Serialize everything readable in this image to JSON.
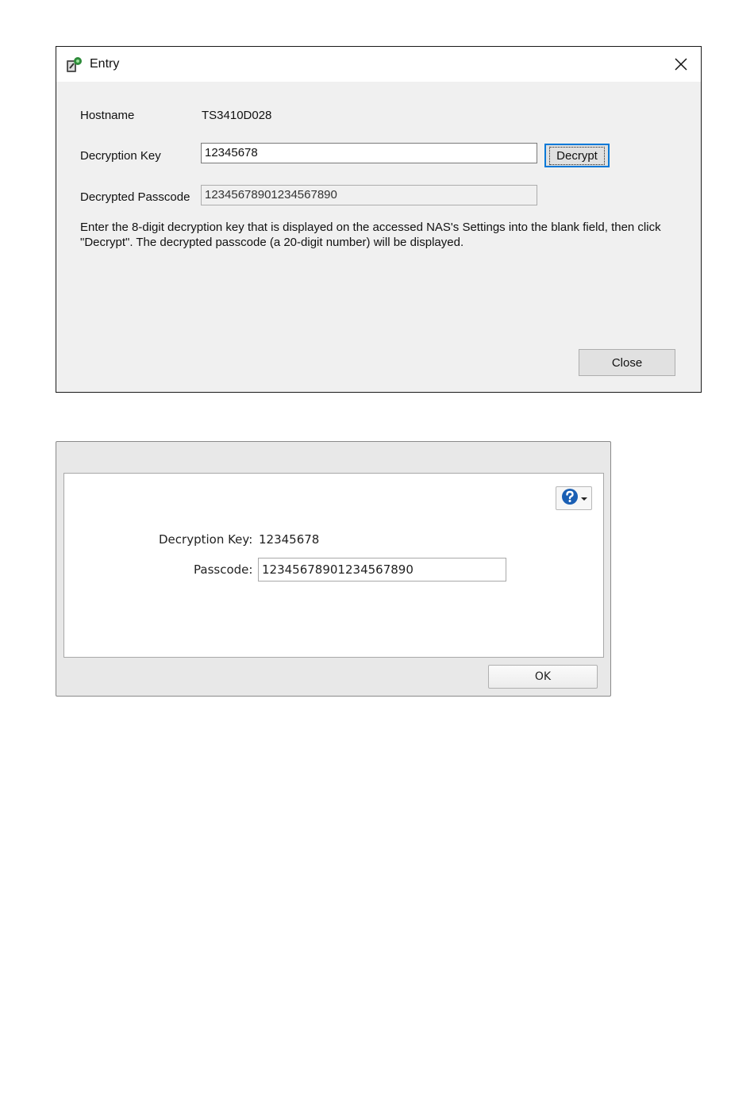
{
  "entry_dialog": {
    "title": "Entry",
    "hostname_label": "Hostname",
    "hostname_value": "TS3410D028",
    "decryption_key_label": "Decryption Key",
    "decryption_key_value": "12345678",
    "decrypt_button": "Decrypt",
    "decrypted_passcode_label": "Decrypted Passcode",
    "decrypted_passcode_value": "12345678901234567890",
    "description_line1": "Enter the 8-digit decryption key that is displayed on the accessed NAS's Settings into the blank field, then click",
    "description_line2": "\"Decrypt\". The decrypted passcode (a 20-digit number) will be displayed.",
    "close_button": "Close",
    "icons": {
      "app": "app-key-icon",
      "close": "close-icon"
    }
  },
  "passcode_dialog": {
    "decryption_key_label": "Decryption Key:",
    "decryption_key_value": "12345678",
    "passcode_label": "Passcode:",
    "passcode_value": "12345678901234567890",
    "ok_button": "OK",
    "icons": {
      "help": "help-icon",
      "dropdown": "chevron-down-icon"
    },
    "colors": {
      "help_blue": "#1a5fb4"
    }
  }
}
